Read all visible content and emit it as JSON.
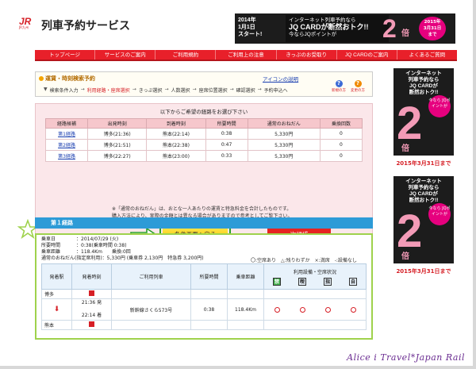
{
  "header": {
    "logo_text": "JR",
    "logo_sub": "JR九州",
    "title": "列車予約サービス",
    "banner": {
      "date_line1": "2014年",
      "date_line2": "1月1日",
      "date_line3": "スタート!",
      "mid_line1": "インターネット列車予約なら",
      "mid_line2": "JQ CARDが断然おトク!!",
      "mid_line3": "今ならJQポイントが",
      "two": "2",
      "bai": "倍",
      "end_line1": "2015年",
      "end_line2": "3月31日",
      "end_line3": "まで"
    }
  },
  "nav": [
    "トップページ",
    "サービスのご案内",
    "ご利用規約",
    "ご利用上の注意",
    "きっぷのお受取り",
    "JQ CARDのご案内",
    "よくあるご質問"
  ],
  "steps_box": {
    "title": "運賃・時刻検索予約",
    "icon_help": "アイコンの説明",
    "steps": [
      {
        "label": "検索条件入力",
        "current": false
      },
      {
        "label": "利用経路・座席選択",
        "current": true
      },
      {
        "label": "きっぷ選択",
        "current": false
      },
      {
        "label": "人数選択",
        "current": false
      },
      {
        "label": "座席位置選択",
        "current": false
      },
      {
        "label": "確認選択",
        "current": false
      },
      {
        "label": "予約申込へ",
        "current": false
      }
    ],
    "help_new": "新規の方",
    "help_change": "変更の方"
  },
  "results": {
    "heading": "以下からご希望の経路をお選び下さい",
    "columns": [
      "経路候補",
      "出発時刻",
      "到着時刻",
      "所要時間",
      "通常のおねだん",
      "乗換回数"
    ],
    "rows": [
      {
        "route": "第1経路",
        "dep": "博多(21:36)",
        "arr": "熊本(22:14)",
        "dur": "0:38",
        "price": "5,330円",
        "transfers": "0"
      },
      {
        "route": "第2経路",
        "dep": "博多(21:51)",
        "arr": "熊本(22:38)",
        "dur": "0:47",
        "price": "5,330円",
        "transfers": "0"
      },
      {
        "route": "第3経路",
        "dep": "博多(22:27)",
        "arr": "熊本(23:00)",
        "dur": "0:33",
        "price": "5,330円",
        "transfers": "0"
      }
    ],
    "note_line1": "※「通常のおねだん」は、おとな一人あたりの運賃と特急料金を合計したものです。",
    "note_line2": "購入方法により、実際の金額とは異なる場合がありますので参考としてご覧下さい。",
    "back_button": "条件画面へ戻る",
    "next_button": "次候補"
  },
  "route": {
    "heading": "第１経路",
    "info": [
      {
        "k": "乗車日",
        "v": "：2014/07/29 (火)"
      },
      {
        "k": "所要時間",
        "v": "：0:38(乗車時間 0:38)"
      },
      {
        "k": "乗車距離",
        "v": "：118.4Km　　乗換:0回"
      }
    ],
    "price_line": "通常のおねだん(指定席利用)：5,330円 (乗車券 2,130円　特急券 3,200円)",
    "legend": "〇:空席あり　△:残りわずか　×:満席　-:設備なし",
    "columns": [
      "発着駅",
      "発着時刻",
      "ご利用列車",
      "所要時間",
      "乗車距離",
      "利用設備・空席状況"
    ],
    "seat_headers": [
      "禁",
      "喫",
      "指",
      "自"
    ],
    "from_station": "博多",
    "to_station": "熊本",
    "dep_time": "21:36 発",
    "arr_time": "22:14 着",
    "train": "新幹線さくら573号",
    "duration": "0:38",
    "distance": "118.4Km"
  },
  "side_banner": {
    "line1": "インターネット",
    "line2": "列車予約なら",
    "line3": "JQ CARDが",
    "line4": "断然おトク!!",
    "now": "今なら JQポイントが",
    "two": "2",
    "bai": "倍",
    "end": "2015年3月31日まで"
  },
  "watermark": "Alice i Travel*Japan Rail"
}
